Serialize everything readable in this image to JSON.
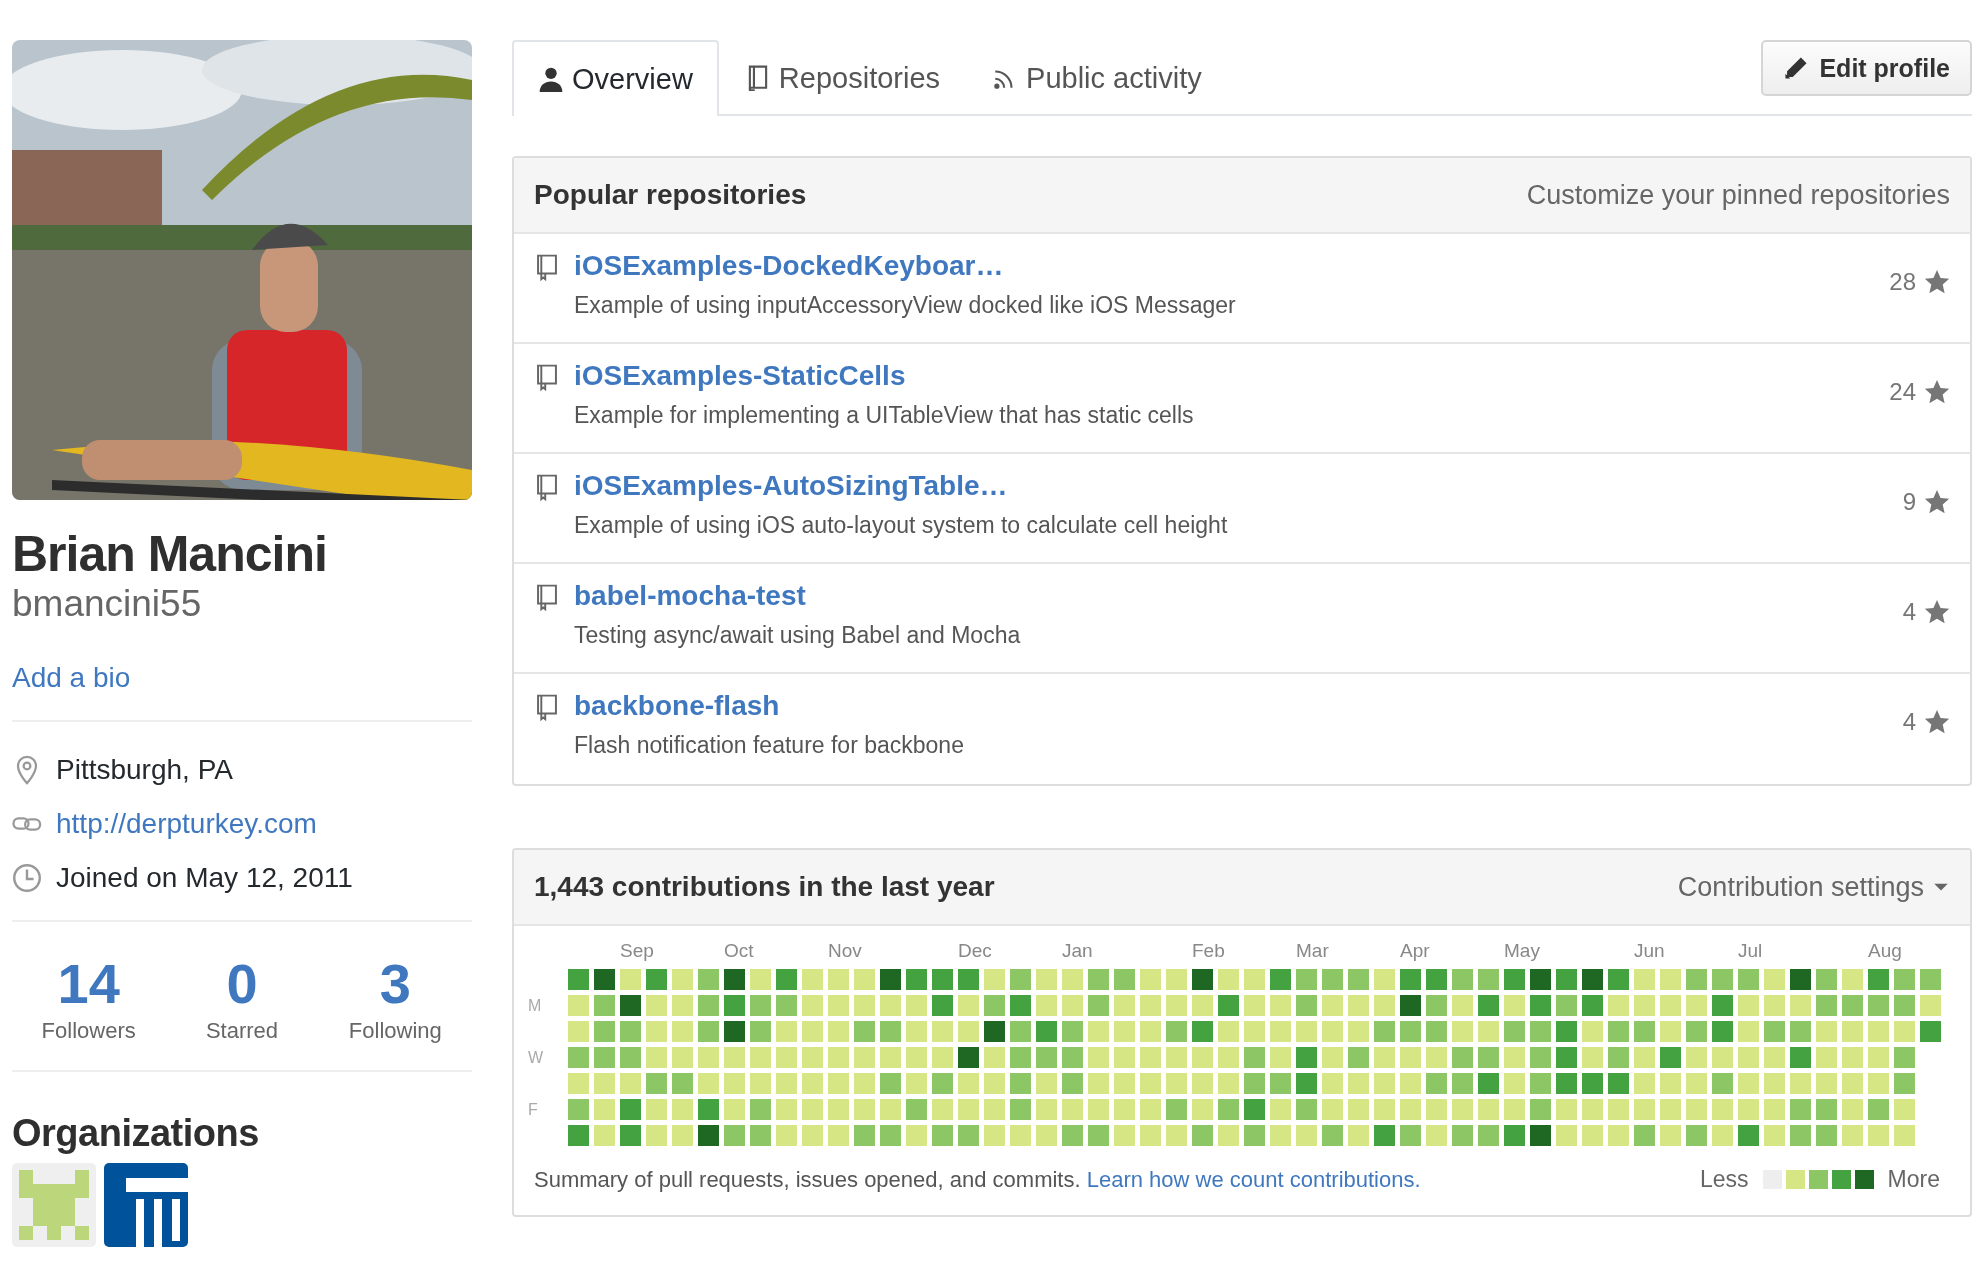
{
  "profile": {
    "name": "Brian Mancini",
    "username": "bmancini55",
    "bio_link": "Add a bio",
    "details": [
      {
        "kind": "location",
        "text": "Pittsburgh, PA"
      },
      {
        "kind": "link",
        "text": "http://derpturkey.com"
      },
      {
        "kind": "joined",
        "text": "Joined on May 12, 2011"
      }
    ],
    "stats": [
      {
        "count": "14",
        "label": "Followers"
      },
      {
        "count": "0",
        "label": "Starred"
      },
      {
        "count": "3",
        "label": "Following"
      }
    ],
    "organizations": {
      "title": "Organizations",
      "items": [
        {
          "kind": "pixel"
        },
        {
          "kind": "pillars"
        }
      ]
    }
  },
  "tabs": [
    {
      "label": "Overview",
      "selected": true
    },
    {
      "label": "Repositories",
      "selected": false
    },
    {
      "label": "Public activity",
      "selected": false
    }
  ],
  "edit_button": "Edit profile",
  "popular": {
    "title": "Popular repositories",
    "action": "Customize your pinned repositories",
    "repos": [
      {
        "name": "iOSExamples-DockedKeyboar…",
        "description": "Example of using inputAccessoryView docked like iOS Messager",
        "star_count": "28"
      },
      {
        "name": "iOSExamples-StaticCells",
        "description": "Example for implementing a UITableView that has static cells",
        "star_count": "24"
      },
      {
        "name": "iOSExamples-AutoSizingTable…",
        "description": "Example of using iOS auto-layout system to calculate cell height",
        "star_count": "9"
      },
      {
        "name": "babel-mocha-test",
        "description": "Testing async/await using Babel and Mocha",
        "star_count": "4"
      },
      {
        "name": "backbone-flash",
        "description": "Flash notification feature for backbone",
        "star_count": "4"
      }
    ]
  },
  "contributions": {
    "title": "1,443 contributions in the last year",
    "settings": "Contribution settings",
    "day_labels": [
      "M",
      "W",
      "F"
    ],
    "weeks": [
      {
        "days": [
          {
            "color": "#44a340"
          },
          {
            "color": "#d6e685"
          },
          {
            "color": "#d6e685"
          },
          {
            "color": "#8cc665"
          },
          {
            "color": "#d6e685"
          },
          {
            "color": "#8cc665"
          },
          {
            "color": "#44a340"
          }
        ]
      },
      {
        "days": [
          {
            "color": "#1e6823"
          },
          {
            "color": "#8cc665"
          },
          {
            "color": "#8cc665"
          },
          {
            "color": "#8cc665"
          },
          {
            "color": "#d6e685"
          },
          {
            "color": "#d6e685"
          },
          {
            "color": "#d6e685"
          }
        ]
      },
      {
        "month": "Sep",
        "days": [
          {
            "color": "#d6e685"
          },
          {
            "color": "#1e6823"
          },
          {
            "color": "#8cc665"
          },
          {
            "color": "#8cc665"
          },
          {
            "color": "#d6e685"
          },
          {
            "color": "#44a340"
          },
          {
            "color": "#44a340"
          }
        ]
      },
      {
        "days": [
          {
            "color": "#44a340"
          },
          {
            "color": "#d6e685"
          },
          {
            "color": "#d6e685"
          },
          {
            "color": "#d6e685"
          },
          {
            "color": "#8cc665"
          },
          {
            "color": "#d6e685"
          },
          {
            "color": "#d6e685"
          }
        ]
      },
      {
        "days": [
          {
            "color": "#d6e685"
          },
          {
            "color": "#d6e685"
          },
          {
            "color": "#d6e685"
          },
          {
            "color": "#d6e685"
          },
          {
            "color": "#8cc665"
          },
          {
            "color": "#d6e685"
          },
          {
            "color": "#d6e685"
          }
        ]
      },
      {
        "days": [
          {
            "color": "#8cc665"
          },
          {
            "color": "#8cc665"
          },
          {
            "color": "#8cc665"
          },
          {
            "color": "#d6e685"
          },
          {
            "color": "#d6e685"
          },
          {
            "color": "#44a340"
          },
          {
            "color": "#1e6823"
          }
        ]
      },
      {
        "month": "Oct",
        "days": [
          {
            "color": "#1e6823"
          },
          {
            "color": "#44a340"
          },
          {
            "color": "#1e6823"
          },
          {
            "color": "#d6e685"
          },
          {
            "color": "#d6e685"
          },
          {
            "color": "#d6e685"
          },
          {
            "color": "#8cc665"
          }
        ]
      },
      {
        "days": [
          {
            "color": "#d6e685"
          },
          {
            "color": "#8cc665"
          },
          {
            "color": "#8cc665"
          },
          {
            "color": "#d6e685"
          },
          {
            "color": "#d6e685"
          },
          {
            "color": "#8cc665"
          },
          {
            "color": "#8cc665"
          }
        ]
      },
      {
        "days": [
          {
            "color": "#44a340"
          },
          {
            "color": "#8cc665"
          },
          {
            "color": "#d6e685"
          },
          {
            "color": "#d6e685"
          },
          {
            "color": "#d6e685"
          },
          {
            "color": "#d6e685"
          },
          {
            "color": "#d6e685"
          }
        ]
      },
      {
        "days": [
          {
            "color": "#d6e685"
          },
          {
            "color": "#d6e685"
          },
          {
            "color": "#d6e685"
          },
          {
            "color": "#d6e685"
          },
          {
            "color": "#d6e685"
          },
          {
            "color": "#d6e685"
          },
          {
            "color": "#d6e685"
          }
        ]
      },
      {
        "month": "Nov",
        "days": [
          {
            "color": "#d6e685"
          },
          {
            "color": "#d6e685"
          },
          {
            "color": "#d6e685"
          },
          {
            "color": "#d6e685"
          },
          {
            "color": "#d6e685"
          },
          {
            "color": "#d6e685"
          },
          {
            "color": "#d6e685"
          }
        ]
      },
      {
        "days": [
          {
            "color": "#d6e685"
          },
          {
            "color": "#d6e685"
          },
          {
            "color": "#8cc665"
          },
          {
            "color": "#d6e685"
          },
          {
            "color": "#d6e685"
          },
          {
            "color": "#d6e685"
          },
          {
            "color": "#8cc665"
          }
        ]
      },
      {
        "days": [
          {
            "color": "#1e6823"
          },
          {
            "color": "#d6e685"
          },
          {
            "color": "#8cc665"
          },
          {
            "color": "#d6e685"
          },
          {
            "color": "#8cc665"
          },
          {
            "color": "#d6e685"
          },
          {
            "color": "#8cc665"
          }
        ]
      },
      {
        "days": [
          {
            "color": "#44a340"
          },
          {
            "color": "#d6e685"
          },
          {
            "color": "#d6e685"
          },
          {
            "color": "#d6e685"
          },
          {
            "color": "#d6e685"
          },
          {
            "color": "#8cc665"
          },
          {
            "color": "#d6e685"
          }
        ]
      },
      {
        "days": [
          {
            "color": "#44a340"
          },
          {
            "color": "#44a340"
          },
          {
            "color": "#d6e685"
          },
          {
            "color": "#d6e685"
          },
          {
            "color": "#8cc665"
          },
          {
            "color": "#d6e685"
          },
          {
            "color": "#8cc665"
          }
        ]
      },
      {
        "month": "Dec",
        "days": [
          {
            "color": "#44a340"
          },
          {
            "color": "#d6e685"
          },
          {
            "color": "#d6e685"
          },
          {
            "color": "#1e6823"
          },
          {
            "color": "#d6e685"
          },
          {
            "color": "#d6e685"
          },
          {
            "color": "#8cc665"
          }
        ]
      },
      {
        "days": [
          {
            "color": "#d6e685"
          },
          {
            "color": "#8cc665"
          },
          {
            "color": "#1e6823"
          },
          {
            "color": "#d6e685"
          },
          {
            "color": "#d6e685"
          },
          {
            "color": "#d6e685"
          },
          {
            "color": "#d6e685"
          }
        ]
      },
      {
        "days": [
          {
            "color": "#8cc665"
          },
          {
            "color": "#44a340"
          },
          {
            "color": "#8cc665"
          },
          {
            "color": "#8cc665"
          },
          {
            "color": "#8cc665"
          },
          {
            "color": "#8cc665"
          },
          {
            "color": "#d6e685"
          }
        ]
      },
      {
        "days": [
          {
            "color": "#d6e685"
          },
          {
            "color": "#d6e685"
          },
          {
            "color": "#44a340"
          },
          {
            "color": "#8cc665"
          },
          {
            "color": "#d6e685"
          },
          {
            "color": "#d6e685"
          },
          {
            "color": "#d6e685"
          }
        ]
      },
      {
        "month": "Jan",
        "days": [
          {
            "color": "#d6e685"
          },
          {
            "color": "#d6e685"
          },
          {
            "color": "#8cc665"
          },
          {
            "color": "#8cc665"
          },
          {
            "color": "#8cc665"
          },
          {
            "color": "#d6e685"
          },
          {
            "color": "#8cc665"
          }
        ]
      },
      {
        "days": [
          {
            "color": "#8cc665"
          },
          {
            "color": "#8cc665"
          },
          {
            "color": "#d6e685"
          },
          {
            "color": "#d6e685"
          },
          {
            "color": "#d6e685"
          },
          {
            "color": "#d6e685"
          },
          {
            "color": "#8cc665"
          }
        ]
      },
      {
        "days": [
          {
            "color": "#8cc665"
          },
          {
            "color": "#d6e685"
          },
          {
            "color": "#d6e685"
          },
          {
            "color": "#d6e685"
          },
          {
            "color": "#d6e685"
          },
          {
            "color": "#d6e685"
          },
          {
            "color": "#d6e685"
          }
        ]
      },
      {
        "days": [
          {
            "color": "#d6e685"
          },
          {
            "color": "#d6e685"
          },
          {
            "color": "#d6e685"
          },
          {
            "color": "#d6e685"
          },
          {
            "color": "#d6e685"
          },
          {
            "color": "#d6e685"
          },
          {
            "color": "#d6e685"
          }
        ]
      },
      {
        "days": [
          {
            "color": "#d6e685"
          },
          {
            "color": "#d6e685"
          },
          {
            "color": "#8cc665"
          },
          {
            "color": "#d6e685"
          },
          {
            "color": "#d6e685"
          },
          {
            "color": "#8cc665"
          },
          {
            "color": "#d6e685"
          }
        ]
      },
      {
        "month": "Feb",
        "days": [
          {
            "color": "#1e6823"
          },
          {
            "color": "#d6e685"
          },
          {
            "color": "#44a340"
          },
          {
            "color": "#d6e685"
          },
          {
            "color": "#d6e685"
          },
          {
            "color": "#d6e685"
          },
          {
            "color": "#8cc665"
          }
        ]
      },
      {
        "days": [
          {
            "color": "#d6e685"
          },
          {
            "color": "#44a340"
          },
          {
            "color": "#d6e685"
          },
          {
            "color": "#d6e685"
          },
          {
            "color": "#d6e685"
          },
          {
            "color": "#8cc665"
          },
          {
            "color": "#d6e685"
          }
        ]
      },
      {
        "days": [
          {
            "color": "#d6e685"
          },
          {
            "color": "#d6e685"
          },
          {
            "color": "#d6e685"
          },
          {
            "color": "#8cc665"
          },
          {
            "color": "#8cc665"
          },
          {
            "color": "#44a340"
          },
          {
            "color": "#8cc665"
          }
        ]
      },
      {
        "days": [
          {
            "color": "#44a340"
          },
          {
            "color": "#d6e685"
          },
          {
            "color": "#d6e685"
          },
          {
            "color": "#d6e685"
          },
          {
            "color": "#8cc665"
          },
          {
            "color": "#d6e685"
          },
          {
            "color": "#d6e685"
          }
        ]
      },
      {
        "month": "Mar",
        "days": [
          {
            "color": "#8cc665"
          },
          {
            "color": "#8cc665"
          },
          {
            "color": "#d6e685"
          },
          {
            "color": "#44a340"
          },
          {
            "color": "#44a340"
          },
          {
            "color": "#8cc665"
          },
          {
            "color": "#d6e685"
          }
        ]
      },
      {
        "days": [
          {
            "color": "#8cc665"
          },
          {
            "color": "#d6e685"
          },
          {
            "color": "#d6e685"
          },
          {
            "color": "#d6e685"
          },
          {
            "color": "#d6e685"
          },
          {
            "color": "#d6e685"
          },
          {
            "color": "#8cc665"
          }
        ]
      },
      {
        "days": [
          {
            "color": "#8cc665"
          },
          {
            "color": "#d6e685"
          },
          {
            "color": "#d6e685"
          },
          {
            "color": "#8cc665"
          },
          {
            "color": "#d6e685"
          },
          {
            "color": "#d6e685"
          },
          {
            "color": "#d6e685"
          }
        ]
      },
      {
        "days": [
          {
            "color": "#d6e685"
          },
          {
            "color": "#d6e685"
          },
          {
            "color": "#8cc665"
          },
          {
            "color": "#d6e685"
          },
          {
            "color": "#d6e685"
          },
          {
            "color": "#d6e685"
          },
          {
            "color": "#44a340"
          }
        ]
      },
      {
        "month": "Apr",
        "days": [
          {
            "color": "#44a340"
          },
          {
            "color": "#1e6823"
          },
          {
            "color": "#8cc665"
          },
          {
            "color": "#d6e685"
          },
          {
            "color": "#d6e685"
          },
          {
            "color": "#d6e685"
          },
          {
            "color": "#8cc665"
          }
        ]
      },
      {
        "days": [
          {
            "color": "#44a340"
          },
          {
            "color": "#8cc665"
          },
          {
            "color": "#8cc665"
          },
          {
            "color": "#d6e685"
          },
          {
            "color": "#8cc665"
          },
          {
            "color": "#d6e685"
          },
          {
            "color": "#d6e685"
          }
        ]
      },
      {
        "days": [
          {
            "color": "#8cc665"
          },
          {
            "color": "#d6e685"
          },
          {
            "color": "#d6e685"
          },
          {
            "color": "#8cc665"
          },
          {
            "color": "#8cc665"
          },
          {
            "color": "#d6e685"
          },
          {
            "color": "#8cc665"
          }
        ]
      },
      {
        "days": [
          {
            "color": "#8cc665"
          },
          {
            "color": "#44a340"
          },
          {
            "color": "#d6e685"
          },
          {
            "color": "#8cc665"
          },
          {
            "color": "#44a340"
          },
          {
            "color": "#d6e685"
          },
          {
            "color": "#8cc665"
          }
        ]
      },
      {
        "month": "May",
        "days": [
          {
            "color": "#44a340"
          },
          {
            "color": "#d6e685"
          },
          {
            "color": "#8cc665"
          },
          {
            "color": "#d6e685"
          },
          {
            "color": "#d6e685"
          },
          {
            "color": "#d6e685"
          },
          {
            "color": "#44a340"
          }
        ]
      },
      {
        "days": [
          {
            "color": "#1e6823"
          },
          {
            "color": "#44a340"
          },
          {
            "color": "#8cc665"
          },
          {
            "color": "#8cc665"
          },
          {
            "color": "#8cc665"
          },
          {
            "color": "#8cc665"
          },
          {
            "color": "#1e6823"
          }
        ]
      },
      {
        "days": [
          {
            "color": "#44a340"
          },
          {
            "color": "#8cc665"
          },
          {
            "color": "#44a340"
          },
          {
            "color": "#44a340"
          },
          {
            "color": "#44a340"
          },
          {
            "color": "#d6e685"
          },
          {
            "color": "#d6e685"
          }
        ]
      },
      {
        "days": [
          {
            "color": "#1e6823"
          },
          {
            "color": "#44a340"
          },
          {
            "color": "#d6e685"
          },
          {
            "color": "#d6e685"
          },
          {
            "color": "#44a340"
          },
          {
            "color": "#d6e685"
          },
          {
            "color": "#d6e685"
          }
        ]
      },
      {
        "days": [
          {
            "color": "#44a340"
          },
          {
            "color": "#d6e685"
          },
          {
            "color": "#8cc665"
          },
          {
            "color": "#8cc665"
          },
          {
            "color": "#44a340"
          },
          {
            "color": "#d6e685"
          },
          {
            "color": "#d6e685"
          }
        ]
      },
      {
        "month": "Jun",
        "days": [
          {
            "color": "#d6e685"
          },
          {
            "color": "#d6e685"
          },
          {
            "color": "#8cc665"
          },
          {
            "color": "#d6e685"
          },
          {
            "color": "#d6e685"
          },
          {
            "color": "#d6e685"
          },
          {
            "color": "#8cc665"
          }
        ]
      },
      {
        "days": [
          {
            "color": "#d6e685"
          },
          {
            "color": "#d6e685"
          },
          {
            "color": "#d6e685"
          },
          {
            "color": "#44a340"
          },
          {
            "color": "#d6e685"
          },
          {
            "color": "#d6e685"
          },
          {
            "color": "#d6e685"
          }
        ]
      },
      {
        "days": [
          {
            "color": "#8cc665"
          },
          {
            "color": "#d6e685"
          },
          {
            "color": "#8cc665"
          },
          {
            "color": "#d6e685"
          },
          {
            "color": "#d6e685"
          },
          {
            "color": "#d6e685"
          },
          {
            "color": "#8cc665"
          }
        ]
      },
      {
        "days": [
          {
            "color": "#8cc665"
          },
          {
            "color": "#44a340"
          },
          {
            "color": "#44a340"
          },
          {
            "color": "#d6e685"
          },
          {
            "color": "#8cc665"
          },
          {
            "color": "#d6e685"
          },
          {
            "color": "#d6e685"
          }
        ]
      },
      {
        "month": "Jul",
        "days": [
          {
            "color": "#8cc665"
          },
          {
            "color": "#d6e685"
          },
          {
            "color": "#d6e685"
          },
          {
            "color": "#d6e685"
          },
          {
            "color": "#d6e685"
          },
          {
            "color": "#d6e685"
          },
          {
            "color": "#44a340"
          }
        ]
      },
      {
        "days": [
          {
            "color": "#d6e685"
          },
          {
            "color": "#d6e685"
          },
          {
            "color": "#8cc665"
          },
          {
            "color": "#d6e685"
          },
          {
            "color": "#d6e685"
          },
          {
            "color": "#d6e685"
          },
          {
            "color": "#d6e685"
          }
        ]
      },
      {
        "days": [
          {
            "color": "#1e6823"
          },
          {
            "color": "#d6e685"
          },
          {
            "color": "#8cc665"
          },
          {
            "color": "#44a340"
          },
          {
            "color": "#d6e685"
          },
          {
            "color": "#8cc665"
          },
          {
            "color": "#8cc665"
          }
        ]
      },
      {
        "days": [
          {
            "color": "#8cc665"
          },
          {
            "color": "#8cc665"
          },
          {
            "color": "#d6e685"
          },
          {
            "color": "#d6e685"
          },
          {
            "color": "#d6e685"
          },
          {
            "color": "#8cc665"
          },
          {
            "color": "#8cc665"
          }
        ]
      },
      {
        "days": [
          {
            "color": "#d6e685"
          },
          {
            "color": "#8cc665"
          },
          {
            "color": "#d6e685"
          },
          {
            "color": "#d6e685"
          },
          {
            "color": "#d6e685"
          },
          {
            "color": "#d6e685"
          },
          {
            "color": "#d6e685"
          }
        ]
      },
      {
        "month": "Aug",
        "days": [
          {
            "color": "#44a340"
          },
          {
            "color": "#8cc665"
          },
          {
            "color": "#d6e685"
          },
          {
            "color": "#d6e685"
          },
          {
            "color": "#d6e685"
          },
          {
            "color": "#8cc665"
          },
          {
            "color": "#d6e685"
          }
        ]
      },
      {
        "days": [
          {
            "color": "#8cc665"
          },
          {
            "color": "#8cc665"
          },
          {
            "color": "#d6e685"
          },
          {
            "color": "#8cc665"
          },
          {
            "color": "#8cc665"
          },
          {
            "color": "#d6e685"
          },
          {
            "color": "#d6e685"
          }
        ]
      },
      {
        "days": [
          {
            "color": "#8cc665"
          },
          {
            "color": "#d6e685"
          },
          {
            "color": "#44a340"
          }
        ]
      }
    ],
    "summary": "Summary of pull requests, issues opened, and commits.",
    "summary_link": "Learn how we count contributions.",
    "legend": {
      "less": "Less",
      "more": "More",
      "swatches": [
        {
          "color": "#eeeeee"
        },
        {
          "color": "#d6e685"
        },
        {
          "color": "#8cc665"
        },
        {
          "color": "#44a340"
        },
        {
          "color": "#1e6823"
        }
      ]
    }
  }
}
